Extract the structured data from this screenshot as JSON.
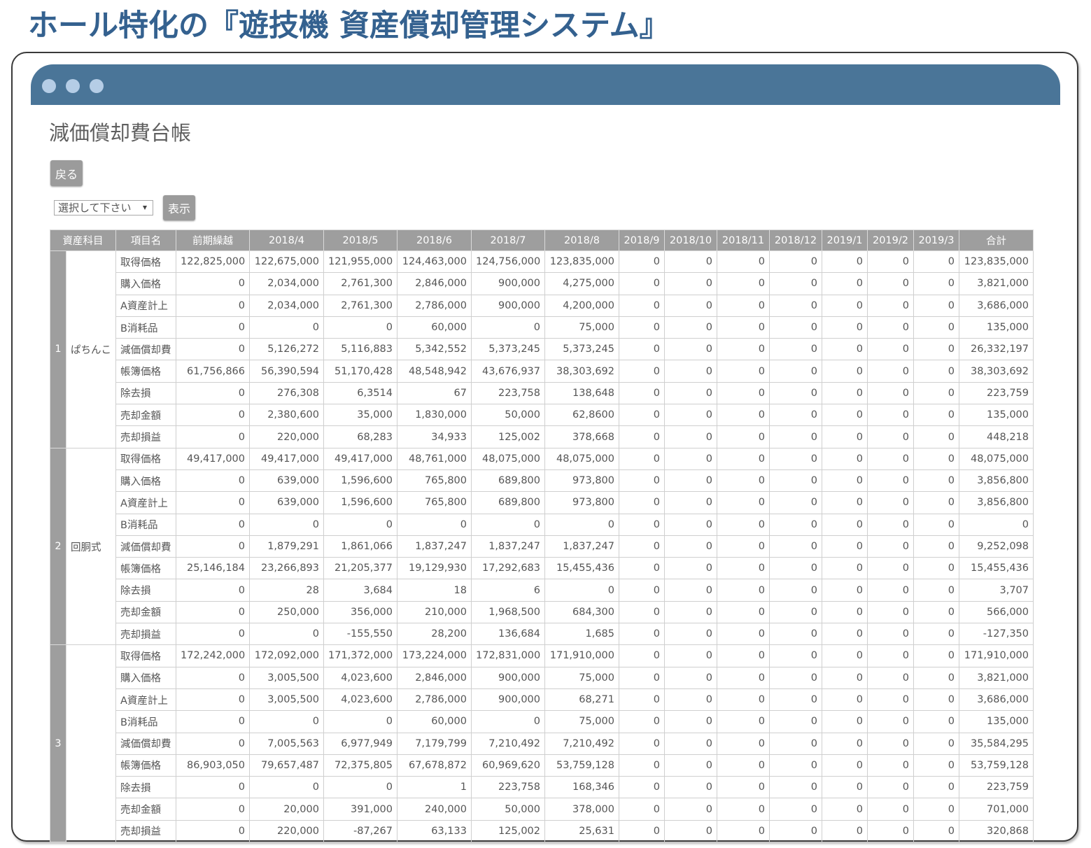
{
  "banner": {
    "title": "ホール特化の『遊技機 資産償却管理システム』"
  },
  "window": {
    "control_icons": [
      "window-dot-icon",
      "window-dot-icon",
      "window-dot-icon"
    ]
  },
  "page": {
    "title": "減価償却費台帳",
    "back_label": "戻る",
    "select": {
      "value": "選択して下さい",
      "icon": "caret-down-icon"
    },
    "show_label": "表示"
  },
  "colors": {
    "banner_text": "#34618f",
    "titlebar": "#4a7598",
    "window_dot": "#b5cde6",
    "header_bg": "#9e9e9e",
    "button_bg": "#9b9b9b",
    "cell_text": "#555555",
    "grid_line": "#cfcfcf"
  },
  "table": {
    "headers": {
      "asset_category": "資産科目",
      "item": "項目名",
      "carryover": "前期繰越",
      "months": [
        "2018/4",
        "2018/5",
        "2018/6",
        "2018/7",
        "2018/8",
        "2018/9",
        "2018/10",
        "2018/11",
        "2018/12",
        "2019/1",
        "2019/2",
        "2019/3"
      ],
      "total": "合計"
    },
    "groups": [
      {
        "no": "1",
        "name": "ぱちんこ",
        "rows": [
          {
            "item": "取得価格",
            "values": [
              "122,825,000",
              "122,675,000",
              "121,955,000",
              "124,463,000",
              "124,756,000",
              "123,835,000",
              "0",
              "0",
              "0",
              "0",
              "0",
              "0",
              "0",
              "123,835,000"
            ]
          },
          {
            "item": "購入価格",
            "values": [
              "0",
              "2,034,000",
              "2,761,300",
              "2,846,000",
              "900,000",
              "4,275,000",
              "0",
              "0",
              "0",
              "0",
              "0",
              "0",
              "0",
              "3,821,000"
            ]
          },
          {
            "item": "A資産計上",
            "values": [
              "0",
              "2,034,000",
              "2,761,300",
              "2,786,000",
              "900,000",
              "4,200,000",
              "0",
              "0",
              "0",
              "0",
              "0",
              "0",
              "0",
              "3,686,000"
            ]
          },
          {
            "item": "B消耗品",
            "values": [
              "0",
              "0",
              "0",
              "60,000",
              "0",
              "75,000",
              "0",
              "0",
              "0",
              "0",
              "0",
              "0",
              "0",
              "135,000"
            ]
          },
          {
            "item": "減価償却費",
            "values": [
              "0",
              "5,126,272",
              "5,116,883",
              "5,342,552",
              "5,373,245",
              "5,373,245",
              "0",
              "0",
              "0",
              "0",
              "0",
              "0",
              "0",
              "26,332,197"
            ]
          },
          {
            "item": "帳簿価格",
            "values": [
              "61,756,866",
              "56,390,594",
              "51,170,428",
              "48,548,942",
              "43,676,937",
              "38,303,692",
              "0",
              "0",
              "0",
              "0",
              "0",
              "0",
              "0",
              "38,303,692"
            ]
          },
          {
            "item": "除去損",
            "values": [
              "0",
              "276,308",
              "6,3514",
              "67",
              "223,758",
              "138,648",
              "0",
              "0",
              "0",
              "0",
              "0",
              "0",
              "0",
              "223,759"
            ]
          },
          {
            "item": "売却金額",
            "values": [
              "0",
              "2,380,600",
              "35,000",
              "1,830,000",
              "50,000",
              "62,8600",
              "0",
              "0",
              "0",
              "0",
              "0",
              "0",
              "0",
              "135,000"
            ]
          },
          {
            "item": "売却損益",
            "values": [
              "0",
              "220,000",
              "68,283",
              "34,933",
              "125,002",
              "378,668",
              "0",
              "0",
              "0",
              "0",
              "0",
              "0",
              "0",
              "448,218"
            ]
          }
        ]
      },
      {
        "no": "2",
        "name": "回胴式",
        "rows": [
          {
            "item": "取得価格",
            "values": [
              "49,417,000",
              "49,417,000",
              "49,417,000",
              "48,761,000",
              "48,075,000",
              "48,075,000",
              "0",
              "0",
              "0",
              "0",
              "0",
              "0",
              "0",
              "48,075,000"
            ]
          },
          {
            "item": "購入価格",
            "values": [
              "0",
              "639,000",
              "1,596,600",
              "765,800",
              "689,800",
              "973,800",
              "0",
              "0",
              "0",
              "0",
              "0",
              "0",
              "0",
              "3,856,800"
            ]
          },
          {
            "item": "A資産計上",
            "values": [
              "0",
              "639,000",
              "1,596,600",
              "765,800",
              "689,800",
              "973,800",
              "0",
              "0",
              "0",
              "0",
              "0",
              "0",
              "0",
              "3,856,800"
            ]
          },
          {
            "item": "B消耗品",
            "values": [
              "0",
              "0",
              "0",
              "0",
              "0",
              "0",
              "0",
              "0",
              "0",
              "0",
              "0",
              "0",
              "0",
              "0"
            ]
          },
          {
            "item": "減価償却費",
            "values": [
              "0",
              "1,879,291",
              "1,861,066",
              "1,837,247",
              "1,837,247",
              "1,837,247",
              "0",
              "0",
              "0",
              "0",
              "0",
              "0",
              "0",
              "9,252,098"
            ]
          },
          {
            "item": "帳簿価格",
            "values": [
              "25,146,184",
              "23,266,893",
              "21,205,377",
              "19,129,930",
              "17,292,683",
              "15,455,436",
              "0",
              "0",
              "0",
              "0",
              "0",
              "0",
              "0",
              "15,455,436"
            ]
          },
          {
            "item": "除去損",
            "values": [
              "0",
              "28",
              "3,684",
              "18",
              "6",
              "0",
              "0",
              "0",
              "0",
              "0",
              "0",
              "0",
              "0",
              "3,707"
            ]
          },
          {
            "item": "売却金額",
            "values": [
              "0",
              "250,000",
              "356,000",
              "210,000",
              "1,968,500",
              "684,300",
              "0",
              "0",
              "0",
              "0",
              "0",
              "0",
              "0",
              "566,000"
            ]
          },
          {
            "item": "売却損益",
            "values": [
              "0",
              "0",
              "-155,550",
              "28,200",
              "136,684",
              "1,685",
              "0",
              "0",
              "0",
              "0",
              "0",
              "0",
              "0",
              "-127,350"
            ]
          }
        ]
      },
      {
        "no": "3",
        "name": "",
        "rows": [
          {
            "item": "取得価格",
            "values": [
              "172,242,000",
              "172,092,000",
              "171,372,000",
              "173,224,000",
              "172,831,000",
              "171,910,000",
              "0",
              "0",
              "0",
              "0",
              "0",
              "0",
              "0",
              "171,910,000"
            ]
          },
          {
            "item": "購入価格",
            "values": [
              "0",
              "3,005,500",
              "4,023,600",
              "2,846,000",
              "900,000",
              "75,000",
              "0",
              "0",
              "0",
              "0",
              "0",
              "0",
              "0",
              "3,821,000"
            ]
          },
          {
            "item": "A資産計上",
            "values": [
              "0",
              "3,005,500",
              "4,023,600",
              "2,786,000",
              "900,000",
              "68,271",
              "0",
              "0",
              "0",
              "0",
              "0",
              "0",
              "0",
              "3,686,000"
            ]
          },
          {
            "item": "B消耗品",
            "values": [
              "0",
              "0",
              "0",
              "60,000",
              "0",
              "75,000",
              "0",
              "0",
              "0",
              "0",
              "0",
              "0",
              "0",
              "135,000"
            ]
          },
          {
            "item": "減価償却費",
            "values": [
              "0",
              "7,005,563",
              "6,977,949",
              "7,179,799",
              "7,210,492",
              "7,210,492",
              "0",
              "0",
              "0",
              "0",
              "0",
              "0",
              "0",
              "35,584,295"
            ]
          },
          {
            "item": "帳簿価格",
            "values": [
              "86,903,050",
              "79,657,487",
              "72,375,805",
              "67,678,872",
              "60,969,620",
              "53,759,128",
              "0",
              "0",
              "0",
              "0",
              "0",
              "0",
              "0",
              "53,759,128"
            ]
          },
          {
            "item": "除去損",
            "values": [
              "0",
              "0",
              "0",
              "1",
              "223,758",
              "168,346",
              "0",
              "0",
              "0",
              "0",
              "0",
              "0",
              "0",
              "223,759"
            ]
          },
          {
            "item": "売却金額",
            "values": [
              "0",
              "20,000",
              "391,000",
              "240,000",
              "50,000",
              "378,000",
              "0",
              "0",
              "0",
              "0",
              "0",
              "0",
              "0",
              "701,000"
            ]
          },
          {
            "item": "売却損益",
            "values": [
              "0",
              "220,000",
              "-87,267",
              "63,133",
              "125,002",
              "25,631",
              "0",
              "0",
              "0",
              "0",
              "0",
              "0",
              "0",
              "320,868"
            ]
          }
        ]
      }
    ]
  }
}
